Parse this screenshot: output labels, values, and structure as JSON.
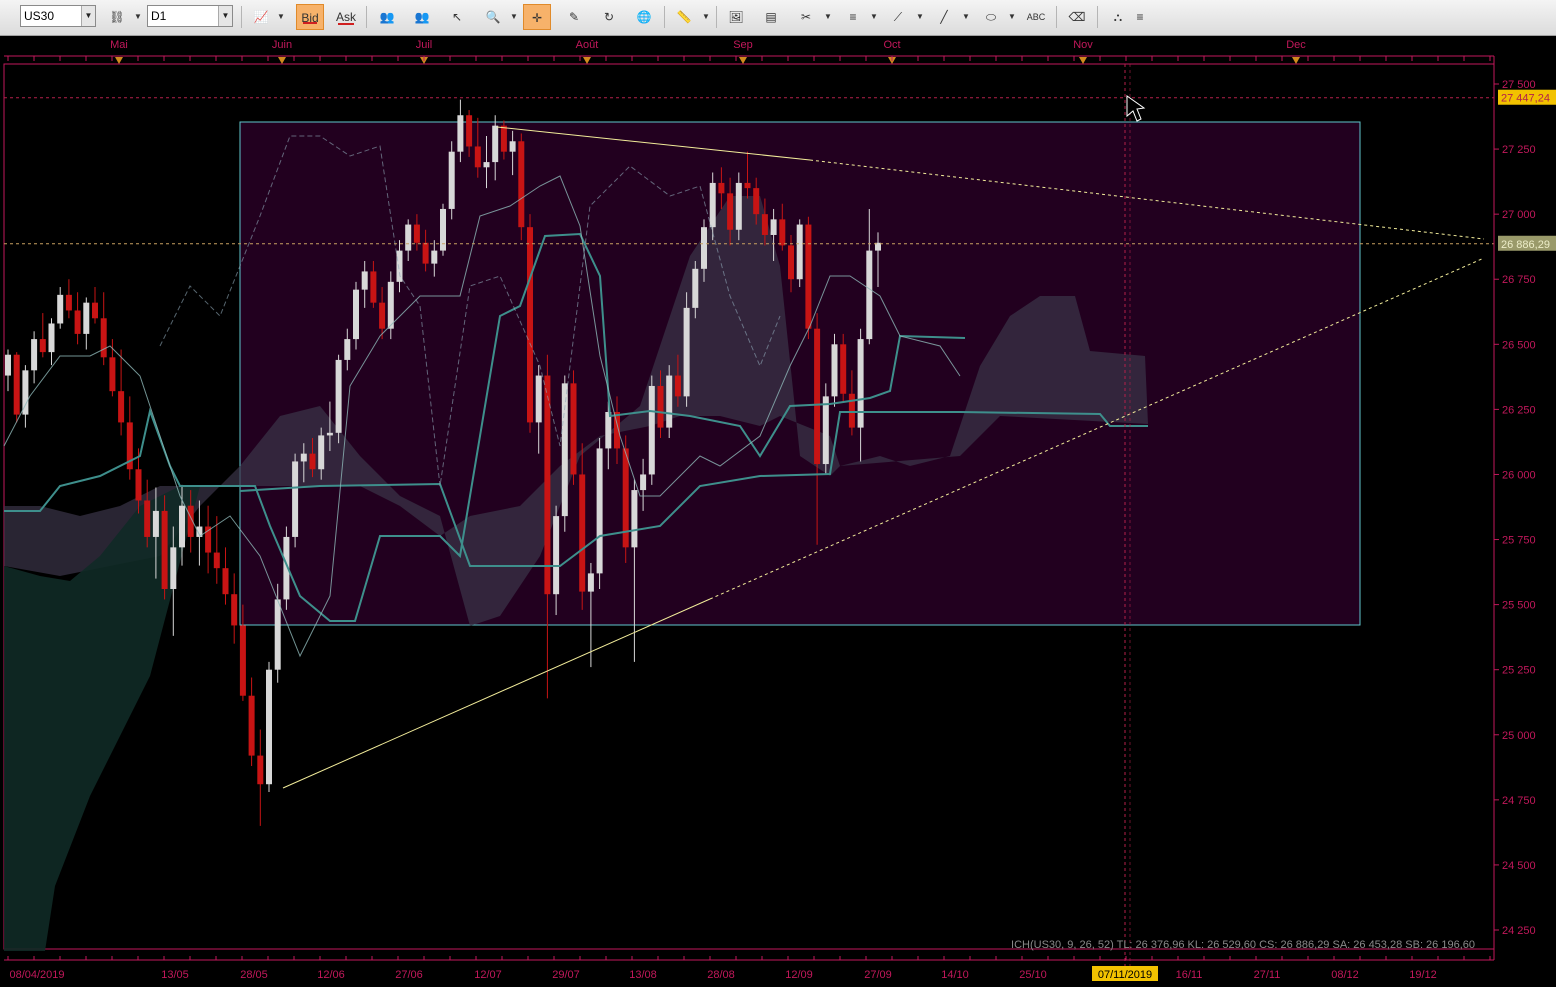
{
  "toolbar": {
    "symbol": "US30",
    "timeframe": "D1",
    "bid_label": "Bid",
    "ask_label": "Ask",
    "tools": [
      "chain-link-icon",
      "chart-type-icon",
      "people-icon",
      "people-icon",
      "pointer-icon",
      "zoom-icon",
      "crosshair-icon",
      "edit-chart-icon",
      "refresh-icon",
      "globe-icon",
      "ruler-icon",
      "image-icon",
      "template-icon",
      "tools-icon",
      "lines-icon",
      "fan-icon",
      "trendline-icon",
      "ellipse-icon",
      "text-abc-icon",
      "eraser-icon",
      "network-icon",
      "more-icon"
    ]
  },
  "chart": {
    "top_months": [
      "Mai",
      "Juin",
      "Juil",
      "Août",
      "Sep",
      "Oct",
      "Nov",
      "Dec"
    ],
    "bottom_dates": [
      "08/04/2019",
      "13/05",
      "28/05",
      "12/06",
      "27/06",
      "12/07",
      "29/07",
      "13/08",
      "28/08",
      "12/09",
      "27/09",
      "14/10",
      "25/10",
      "07/11/2019",
      "16/11",
      "27/11",
      "08/12",
      "19/12"
    ],
    "cursor_date": "07/11/2019",
    "price_labels": [
      "27 500",
      "27 250",
      "27 000",
      "26 750",
      "26 500",
      "26 250",
      "26 000",
      "25 750",
      "25 500",
      "25 250",
      "25 000",
      "24 750",
      "24 500",
      "24 250"
    ],
    "high_marker": "27 447,24",
    "current_price": "26 886,29",
    "indicator_text": "ICH(US30, 9, 26, 52)  TL: 26 376,96  KL: 26 529,60  CS: 26 886,29  SA: 26 453,28  SB: 26 196,60",
    "colors": {
      "axis": "#c2185b",
      "bull": "#d8d8d8",
      "bear": "#c81414",
      "cloud": "#3a3448",
      "box_fill": "#22001f",
      "box_border": "#5fc6cc",
      "kijun": "#3e8f8c",
      "trend": "#f2ec9a"
    }
  },
  "chart_data": {
    "type": "candlestick",
    "ohlc": [
      [
        26380,
        26480,
        26320,
        26460
      ],
      [
        26460,
        26470,
        26200,
        26230
      ],
      [
        26230,
        26420,
        26180,
        26400
      ],
      [
        26400,
        26550,
        26350,
        26520
      ],
      [
        26520,
        26620,
        26450,
        26470
      ],
      [
        26470,
        26600,
        26420,
        26580
      ],
      [
        26580,
        26720,
        26560,
        26690
      ],
      [
        26690,
        26750,
        26600,
        26630
      ],
      [
        26630,
        26700,
        26500,
        26540
      ],
      [
        26540,
        26680,
        26480,
        26660
      ],
      [
        26660,
        26720,
        26580,
        26600
      ],
      [
        26600,
        26700,
        26420,
        26450
      ],
      [
        26450,
        26520,
        26300,
        26320
      ],
      [
        26320,
        26480,
        26150,
        26200
      ],
      [
        26200,
        26300,
        25980,
        26020
      ],
      [
        26020,
        26100,
        25850,
        25900
      ],
      [
        25900,
        25980,
        25720,
        25760
      ],
      [
        25760,
        25950,
        25600,
        25860
      ],
      [
        25860,
        25920,
        25520,
        25560
      ],
      [
        25560,
        25800,
        25380,
        25720
      ],
      [
        25720,
        25960,
        25650,
        25880
      ],
      [
        25880,
        25940,
        25700,
        25760
      ],
      [
        25760,
        25900,
        25650,
        25800
      ],
      [
        25800,
        25880,
        25620,
        25700
      ],
      [
        25700,
        25840,
        25580,
        25640
      ],
      [
        25640,
        25720,
        25500,
        25540
      ],
      [
        25540,
        25620,
        25350,
        25420
      ],
      [
        25420,
        25500,
        25130,
        25150
      ],
      [
        25150,
        25220,
        24880,
        24920
      ],
      [
        24920,
        25020,
        24650,
        24810
      ],
      [
        24810,
        25280,
        24780,
        25250
      ],
      [
        25250,
        25580,
        25200,
        25520
      ],
      [
        25520,
        25800,
        25480,
        25760
      ],
      [
        25760,
        26080,
        25720,
        26050
      ],
      [
        26050,
        26120,
        25970,
        26080
      ],
      [
        26080,
        26140,
        25990,
        26020
      ],
      [
        26020,
        26180,
        25980,
        26150
      ],
      [
        26150,
        26280,
        26090,
        26160
      ],
      [
        26160,
        26460,
        26120,
        26440
      ],
      [
        26440,
        26560,
        26400,
        26520
      ],
      [
        26520,
        26740,
        26480,
        26710
      ],
      [
        26710,
        26820,
        26640,
        26780
      ],
      [
        26780,
        26820,
        26640,
        26660
      ],
      [
        26660,
        26720,
        26520,
        26560
      ],
      [
        26560,
        26780,
        26520,
        26740
      ],
      [
        26740,
        26900,
        26700,
        26860
      ],
      [
        26860,
        26980,
        26820,
        26960
      ],
      [
        26960,
        27000,
        26860,
        26890
      ],
      [
        26890,
        26940,
        26780,
        26810
      ],
      [
        26810,
        26900,
        26760,
        26860
      ],
      [
        26860,
        27040,
        26840,
        27020
      ],
      [
        27020,
        27280,
        26980,
        27240
      ],
      [
        27240,
        27440,
        27200,
        27380
      ],
      [
        27380,
        27400,
        27220,
        27260
      ],
      [
        27260,
        27370,
        27140,
        27180
      ],
      [
        27180,
        27300,
        27100,
        27200
      ],
      [
        27200,
        27380,
        27130,
        27340
      ],
      [
        27340,
        27360,
        27210,
        27240
      ],
      [
        27240,
        27320,
        27150,
        27280
      ],
      [
        27280,
        27310,
        26900,
        26950
      ],
      [
        26950,
        27000,
        26160,
        26200
      ],
      [
        26200,
        26420,
        26080,
        26380
      ],
      [
        26380,
        26460,
        25140,
        25540
      ],
      [
        25540,
        25880,
        25460,
        25840
      ],
      [
        25840,
        26380,
        25780,
        26350
      ],
      [
        26350,
        26400,
        25960,
        26000
      ],
      [
        26000,
        26120,
        25480,
        25550
      ],
      [
        25550,
        25660,
        25260,
        25620
      ],
      [
        25620,
        26140,
        25560,
        26100
      ],
      [
        26100,
        26280,
        26020,
        26240
      ],
      [
        26240,
        26300,
        26040,
        26100
      ],
      [
        26100,
        26150,
        25660,
        25720
      ],
      [
        25720,
        25980,
        25280,
        25940
      ],
      [
        25940,
        26060,
        25860,
        26000
      ],
      [
        26000,
        26380,
        25960,
        26340
      ],
      [
        26340,
        26400,
        26140,
        26180
      ],
      [
        26180,
        26420,
        26140,
        26380
      ],
      [
        26380,
        26460,
        26260,
        26300
      ],
      [
        26300,
        26700,
        26260,
        26640
      ],
      [
        26640,
        26820,
        26600,
        26790
      ],
      [
        26790,
        26980,
        26740,
        26950
      ],
      [
        26950,
        27160,
        26900,
        27120
      ],
      [
        27120,
        27180,
        27020,
        27080
      ],
      [
        27080,
        27140,
        26880,
        26940
      ],
      [
        26940,
        27160,
        26900,
        27120
      ],
      [
        27120,
        27240,
        27060,
        27100
      ],
      [
        27100,
        27140,
        26960,
        27000
      ],
      [
        27000,
        27060,
        26880,
        26920
      ],
      [
        26920,
        27020,
        26820,
        26980
      ],
      [
        26980,
        27040,
        26860,
        26880
      ],
      [
        26880,
        26920,
        26700,
        26750
      ],
      [
        26750,
        26980,
        26720,
        26960
      ],
      [
        26960,
        26990,
        26520,
        26560
      ],
      [
        26560,
        26620,
        25730,
        26040
      ],
      [
        26040,
        26350,
        26000,
        26300
      ],
      [
        26300,
        26540,
        26260,
        26500
      ],
      [
        26500,
        26540,
        26280,
        26310
      ],
      [
        26310,
        26400,
        26150,
        26180
      ],
      [
        26180,
        26560,
        26050,
        26520
      ],
      [
        26520,
        27020,
        26500,
        26860
      ],
      [
        26860,
        26930,
        26720,
        26890
      ]
    ],
    "price_range": [
      24200,
      27560
    ],
    "annotations": [
      "ichimoku cloud",
      "rectangle",
      "symmetrical triangle trendlines"
    ]
  }
}
